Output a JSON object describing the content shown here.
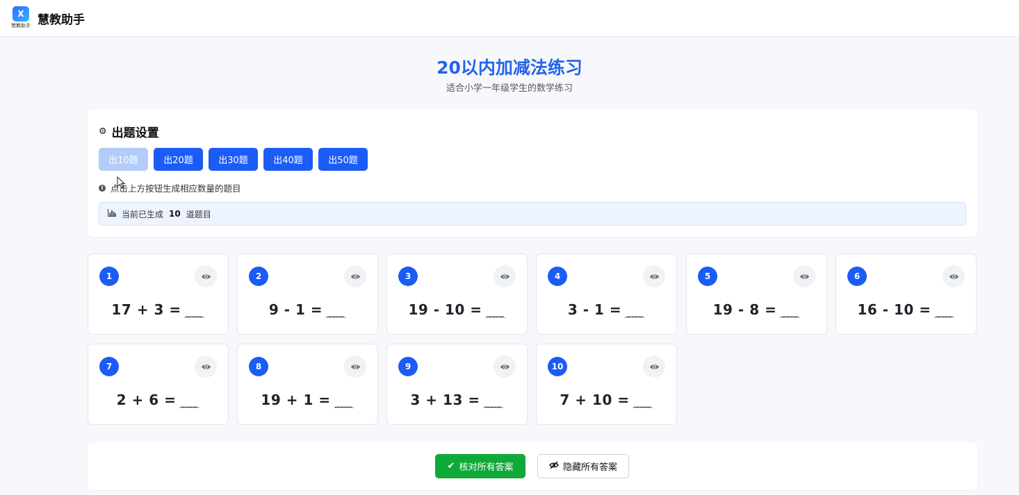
{
  "app": {
    "logo_text": "X",
    "logo_caption": "慧教助手",
    "name": "慧教助手"
  },
  "page": {
    "title": "20以内加减法练习",
    "subtitle": "适合小学一年级学生的数学练习"
  },
  "settings": {
    "title": "出题设置",
    "buttons": [
      {
        "label": "出10题",
        "active": true
      },
      {
        "label": "出20题",
        "active": false
      },
      {
        "label": "出30题",
        "active": false
      },
      {
        "label": "出40题",
        "active": false
      },
      {
        "label": "出50题",
        "active": false
      }
    ],
    "hint": "点击上方按钮生成相应数量的题目",
    "status_prefix": "当前已生成",
    "status_count": "10",
    "status_suffix": "道题目"
  },
  "problems": [
    {
      "num": "1",
      "expr": "17 + 3 ="
    },
    {
      "num": "2",
      "expr": "9 - 1 ="
    },
    {
      "num": "3",
      "expr": "19 - 10 ="
    },
    {
      "num": "4",
      "expr": "3 - 1 ="
    },
    {
      "num": "5",
      "expr": "19 - 8 ="
    },
    {
      "num": "6",
      "expr": "16 - 10 ="
    },
    {
      "num": "7",
      "expr": "2 + 6 ="
    },
    {
      "num": "8",
      "expr": "19 + 1 ="
    },
    {
      "num": "9",
      "expr": "3 + 13 ="
    },
    {
      "num": "10",
      "expr": "7 + 10 ="
    }
  ],
  "answer_blank": "___",
  "actions": {
    "check_all": "核对所有答案",
    "hide_all": "隐藏所有答案"
  },
  "colors": {
    "primary": "#1a5cf5",
    "title_blue": "#2563eb",
    "success": "#0fa93a"
  }
}
